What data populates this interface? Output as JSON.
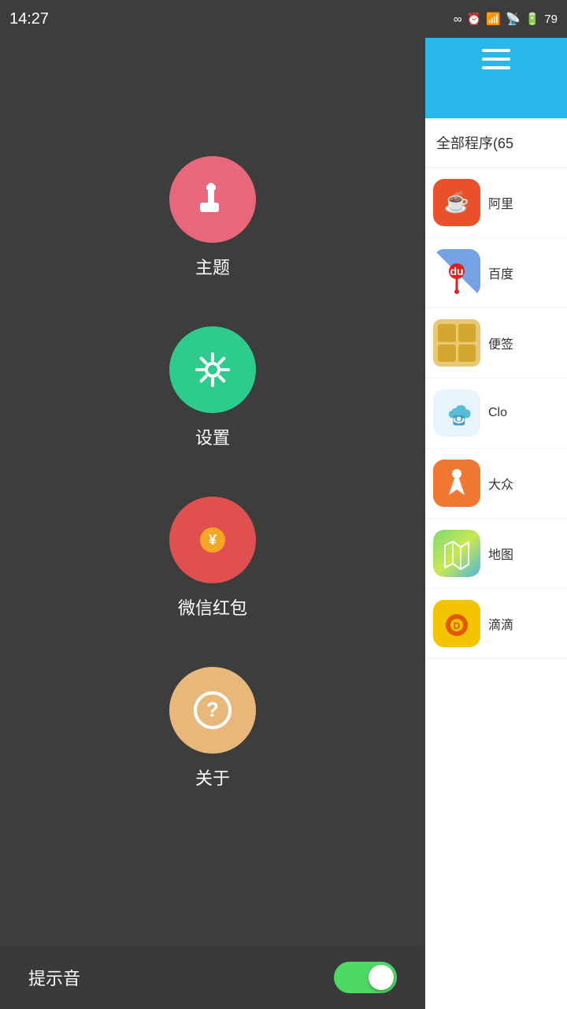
{
  "statusBar": {
    "time": "14:27",
    "battery": "79"
  },
  "leftPanel": {
    "menuItems": [
      {
        "id": "theme",
        "label": "主题",
        "colorClass": "circle-theme"
      },
      {
        "id": "settings",
        "label": "设置",
        "colorClass": "circle-settings"
      },
      {
        "id": "redpacket",
        "label": "微信红包",
        "colorClass": "circle-redpacket"
      },
      {
        "id": "about",
        "label": "关于",
        "colorClass": "circle-about"
      }
    ],
    "bottomToggle": {
      "label": "提示音",
      "enabled": true
    }
  },
  "rightPanel": {
    "menuIcon": "hamburger",
    "allAppsHeader": "全部程序(65",
    "apps": [
      {
        "id": "alibaba",
        "name": "阿里",
        "iconType": "alibaba"
      },
      {
        "id": "baidu",
        "name": "百度",
        "iconType": "baidu"
      },
      {
        "id": "notes",
        "name": "便签",
        "iconType": "notes"
      },
      {
        "id": "cloudsec",
        "name": "Clo",
        "iconType": "cloudsec"
      },
      {
        "id": "dazhi",
        "name": "大众",
        "iconType": "dazhi"
      },
      {
        "id": "maps",
        "name": "地图",
        "iconType": "maps"
      },
      {
        "id": "didi",
        "name": "滴滴",
        "iconType": "didi"
      }
    ]
  }
}
